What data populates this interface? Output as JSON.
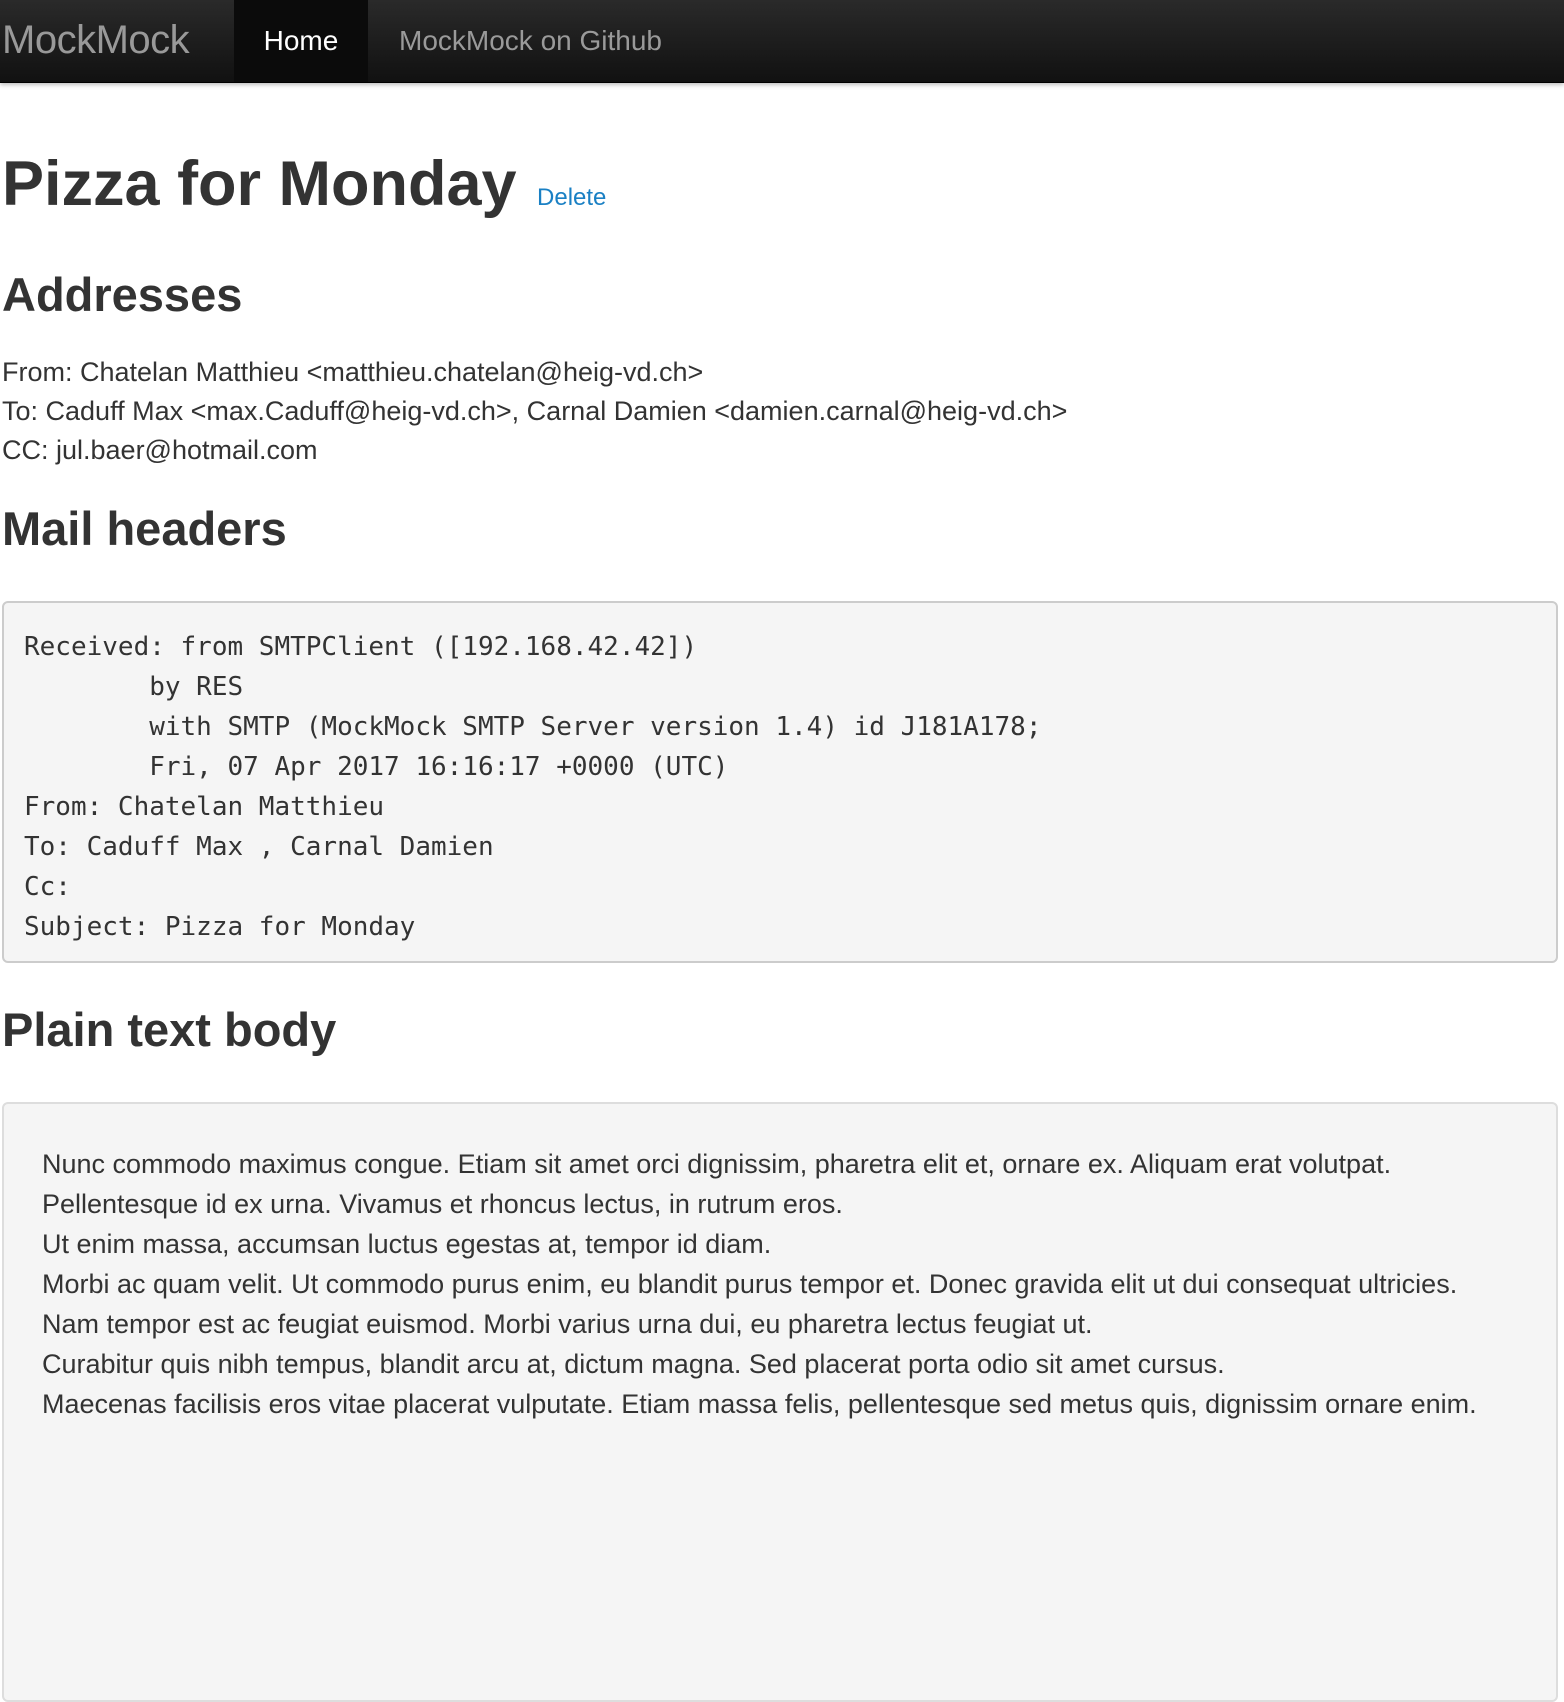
{
  "navbar": {
    "brand": "MockMock",
    "items": [
      {
        "label": "Home",
        "active": true
      },
      {
        "label": "MockMock on Github",
        "active": false
      }
    ]
  },
  "email": {
    "subject": "Pizza for Monday",
    "delete_label": "Delete",
    "addresses_heading": "Addresses",
    "from_line": "From: Chatelan Matthieu <matthieu.chatelan@heig-vd.ch>",
    "to_line": "To: Caduff Max <max.Caduff@heig-vd.ch>, Carnal Damien <damien.carnal@heig-vd.ch>",
    "cc_line": "CC: jul.baer@hotmail.com",
    "headers_heading": "Mail headers",
    "headers_lines": [
      "Received: from SMTPClient ([192.168.42.42])",
      "        by RES",
      "        with SMTP (MockMock SMTP Server version 1.4) id J181A178;",
      "        Fri, 07 Apr 2017 16:16:17 +0000 (UTC)",
      "From: Chatelan Matthieu",
      "To: Caduff Max , Carnal Damien",
      "Cc:",
      "Subject: Pizza for Monday"
    ],
    "body_heading": "Plain text body",
    "body_lines": [
      "Nunc commodo maximus congue. Etiam sit amet orci dignissim, pharetra elit et, ornare ex. Aliquam erat volutpat.",
      "Pellentesque id ex urna. Vivamus et rhoncus lectus, in rutrum eros.",
      "Ut enim massa, accumsan luctus egestas at, tempor id diam.",
      "Morbi ac quam velit. Ut commodo purus enim, eu blandit purus tempor et. Donec gravida elit ut dui consequat ultricies.",
      "Nam tempor est ac feugiat euismod. Morbi varius urna dui, eu pharetra lectus feugiat ut.",
      "Curabitur quis nibh tempus, blandit arcu at, dictum magna. Sed placerat porta odio sit amet cursus.",
      "Maecenas facilisis eros vitae placerat vulputate. Etiam massa felis, pellentesque sed metus quis, dignissim ornare enim."
    ]
  },
  "colors": {
    "navbar_bg": "#1b1b1b",
    "link": "#1a80c4",
    "text": "#333333",
    "pre_bg": "#f5f5f5"
  }
}
